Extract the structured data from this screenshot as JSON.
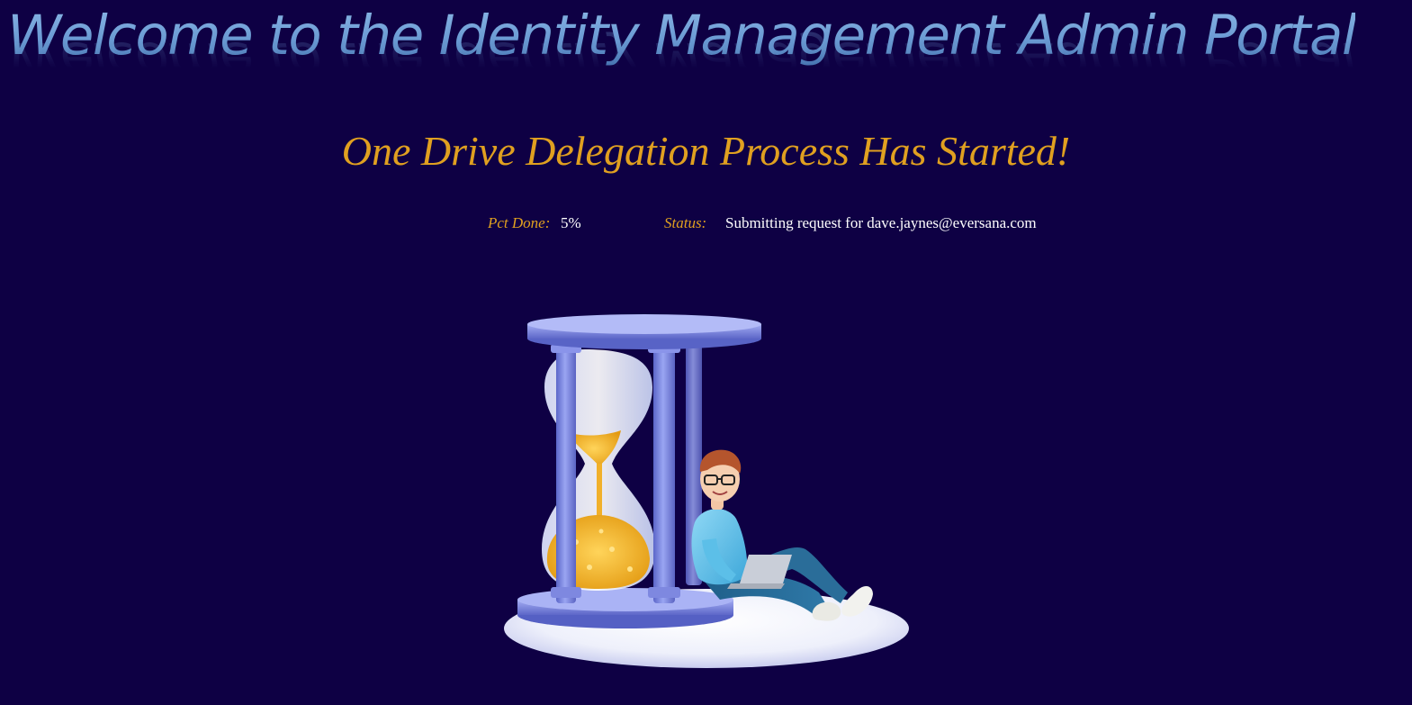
{
  "banner": {
    "title": "Welcome to the Identity Management Admin Portal"
  },
  "main": {
    "heading": "One Drive Delegation Process Has Started!",
    "progress": {
      "pct_label": "Pct Done:",
      "pct_value": "5%",
      "status_label": "Status:",
      "status_value": "Submitting request for dave.jaynes@eversana.com"
    },
    "illustration": {
      "icon": "hourglass-with-person-illustration"
    }
  },
  "colors": {
    "background": "#0e0044",
    "accent": "#e0a020",
    "banner_text": "#6f9fd4",
    "value_text": "#ffffff"
  }
}
